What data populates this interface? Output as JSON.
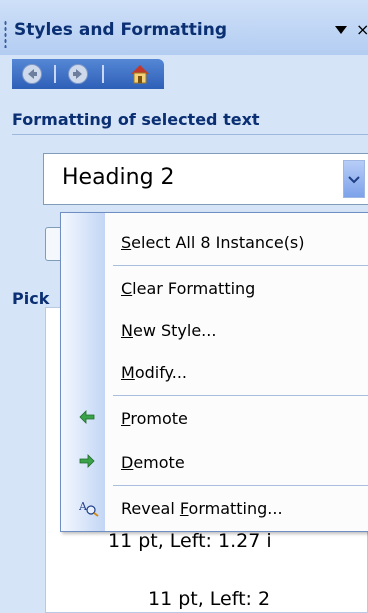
{
  "pane": {
    "title": "Styles and Formatting",
    "close_glyph": "×",
    "section_label": "Formatting of selected text",
    "pick_label": "Pick"
  },
  "nav": {
    "back_icon": "back-arrow-icon",
    "forward_icon": "forward-arrow-icon",
    "home_icon": "home-icon"
  },
  "selected_style": {
    "value": "Heading 2"
  },
  "menu": {
    "items": [
      {
        "label": "Select All 8 Instance(s)",
        "accel": "S",
        "icon": null
      },
      {
        "label": "Clear Formatting",
        "accel": "C",
        "icon": null
      },
      {
        "label": "New Style...",
        "accel": "N",
        "icon": null
      },
      {
        "label": "Modify...",
        "accel": "M",
        "icon": null
      },
      {
        "label": "Promote",
        "accel": "P",
        "icon": "promote-arrow-icon"
      },
      {
        "label": "Demote",
        "accel": "D",
        "icon": "demote-arrow-icon"
      },
      {
        "label": "Reveal Formatting...",
        "accel": "F",
        "icon": "reveal-formatting-icon"
      }
    ]
  },
  "list": {
    "items": [
      "11 pt, Left:  1.27 i",
      "11 pt, Left:  2"
    ]
  },
  "colors": {
    "pane_bg": "#d6e4f7",
    "title_text": "#0b2f73",
    "nav_bar": "#3a6cc6",
    "promote_green": "#3aa34a"
  }
}
